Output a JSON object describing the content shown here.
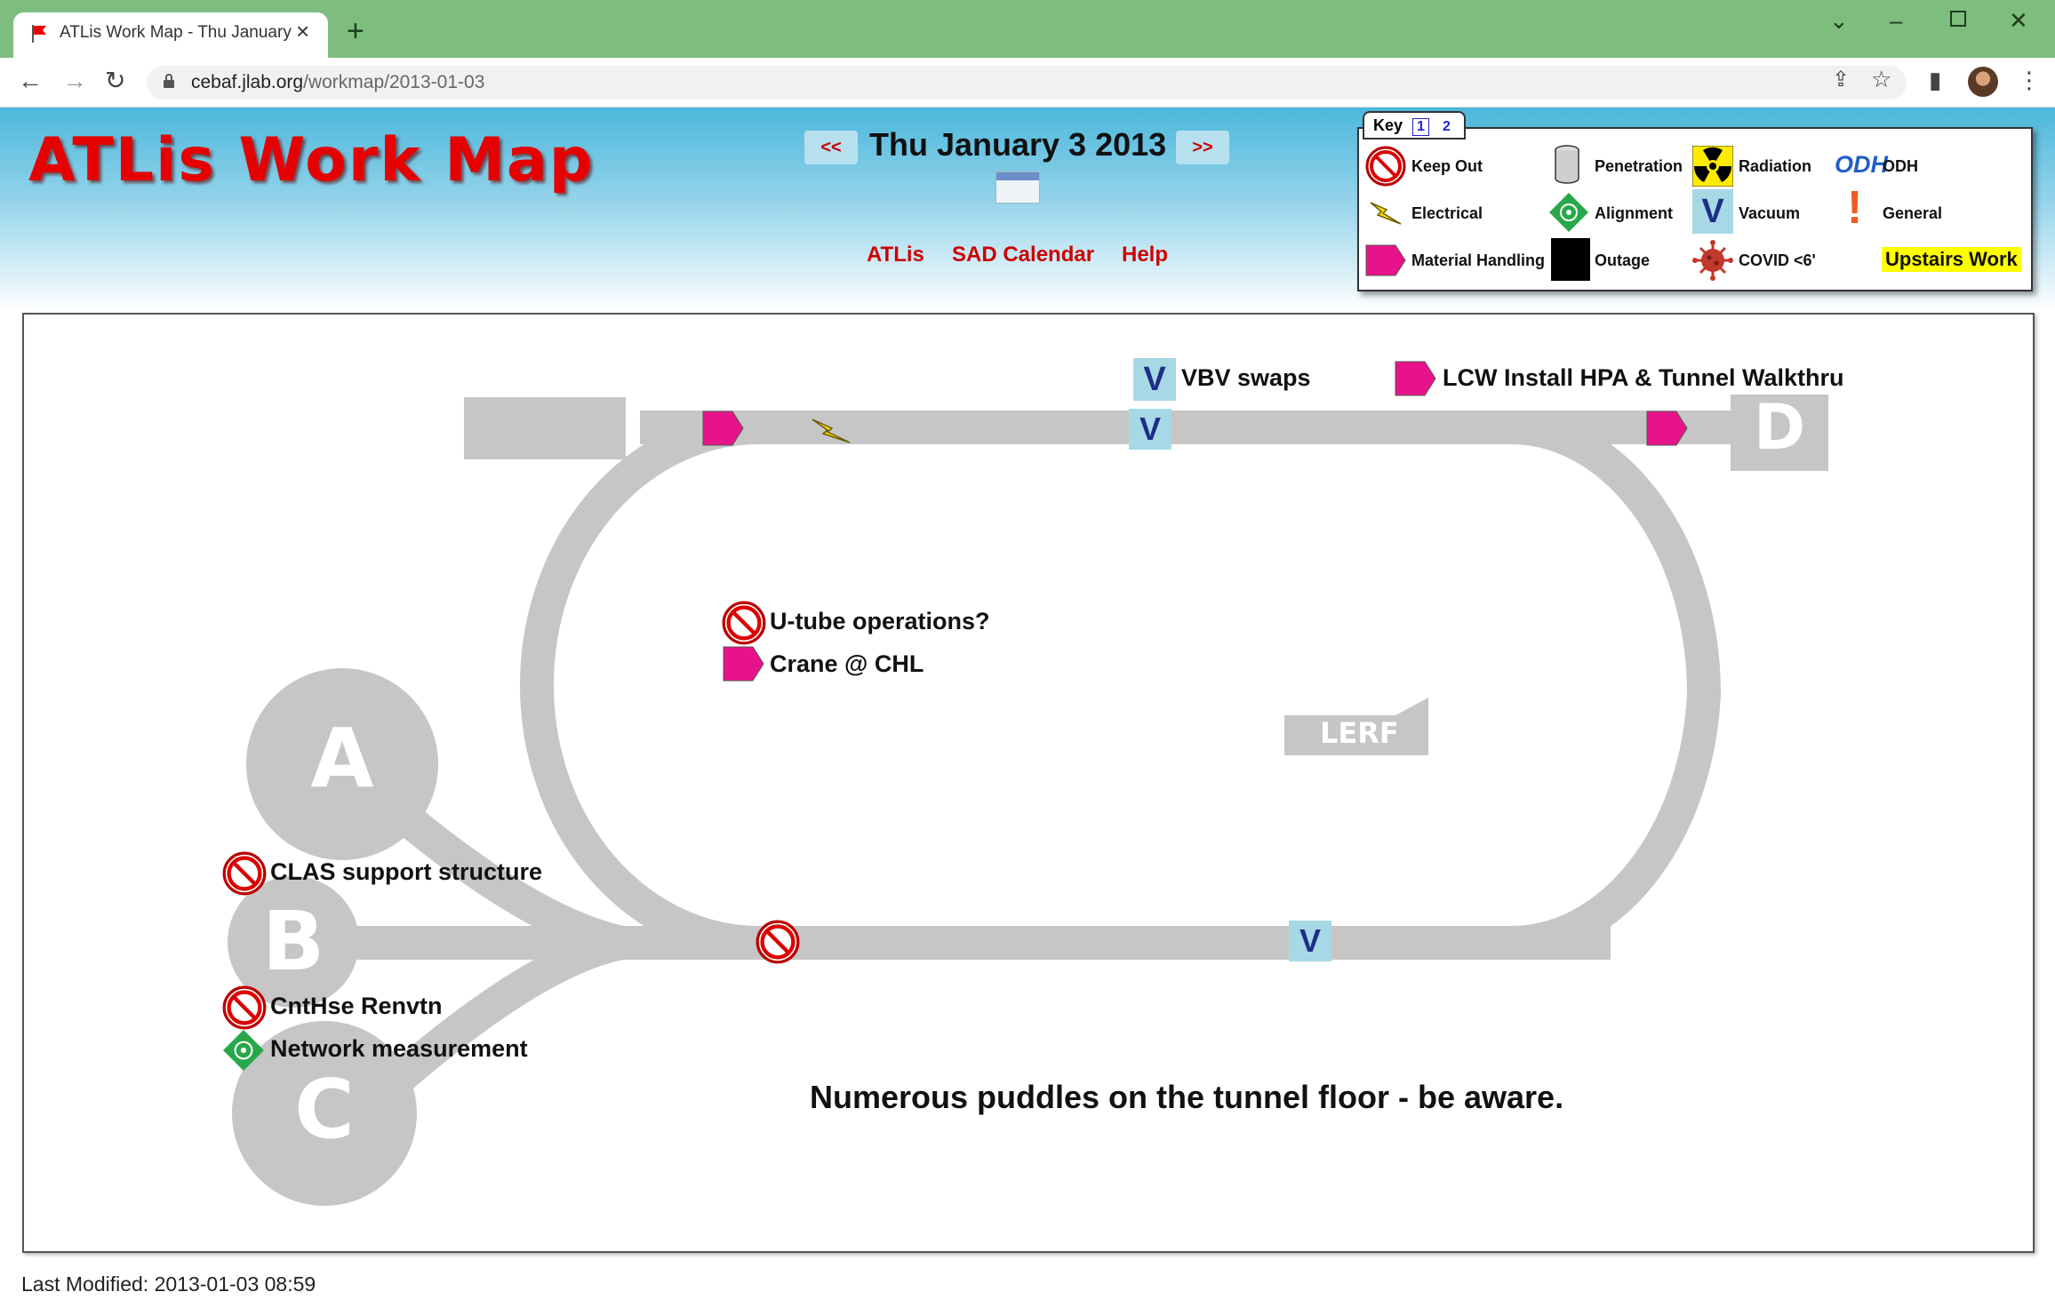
{
  "browser": {
    "tab_title": "ATLis Work Map - Thu January 3 2013",
    "url_host": "cebaf.jlab.org",
    "url_path": "/workmap/2013-01-03"
  },
  "header": {
    "logo": "ATLis Work Map",
    "date": "Thu January 3 2013",
    "prev_arrow": "<<",
    "next_arrow": ">>",
    "links": [
      "ATLis",
      "SAD Calendar",
      "Help"
    ]
  },
  "key": {
    "tab_label": "Key",
    "pages": [
      "1",
      "2"
    ],
    "items": {
      "keep_out": "Keep Out",
      "penetration": "Penetration",
      "radiation": "Radiation",
      "odh_icon_text": "ODH",
      "odh": "ODH",
      "electrical": "Electrical",
      "alignment": "Alignment",
      "vacuum_icon_text": "V",
      "vacuum": "Vacuum",
      "general_icon_text": "!",
      "general": "General",
      "material_handling": "Material Handling",
      "outage": "Outage",
      "covid": "COVID <6'",
      "upstairs": "Upstairs Work"
    }
  },
  "map": {
    "halls": [
      "A",
      "B",
      "C",
      "D"
    ],
    "lerf": "LERF",
    "vacuum_marker_text": "V",
    "work_items": {
      "vbv": "VBV swaps",
      "lcw": "LCW Install HPA & Tunnel Walkthru",
      "utube": "U-tube operations?",
      "crane": "Crane @ CHL",
      "clas": "CLAS support structure",
      "cnthse": "CntHse Renvtn",
      "network": "Network measurement"
    },
    "notice": "Numerous puddles on the tunnel floor - be aware."
  },
  "footer": {
    "last_modified": "Last Modified: 2013-01-03 08:59"
  },
  "colors": {
    "chrome_green": "#7dbd7e",
    "header_blue": "#4cb7db",
    "logo_red": "#e60000",
    "material_magenta": "#e8138a",
    "vacuum_bg": "#a7d8e6",
    "vacuum_text": "#1f2d86",
    "track_gray": "#c6c6c6"
  }
}
